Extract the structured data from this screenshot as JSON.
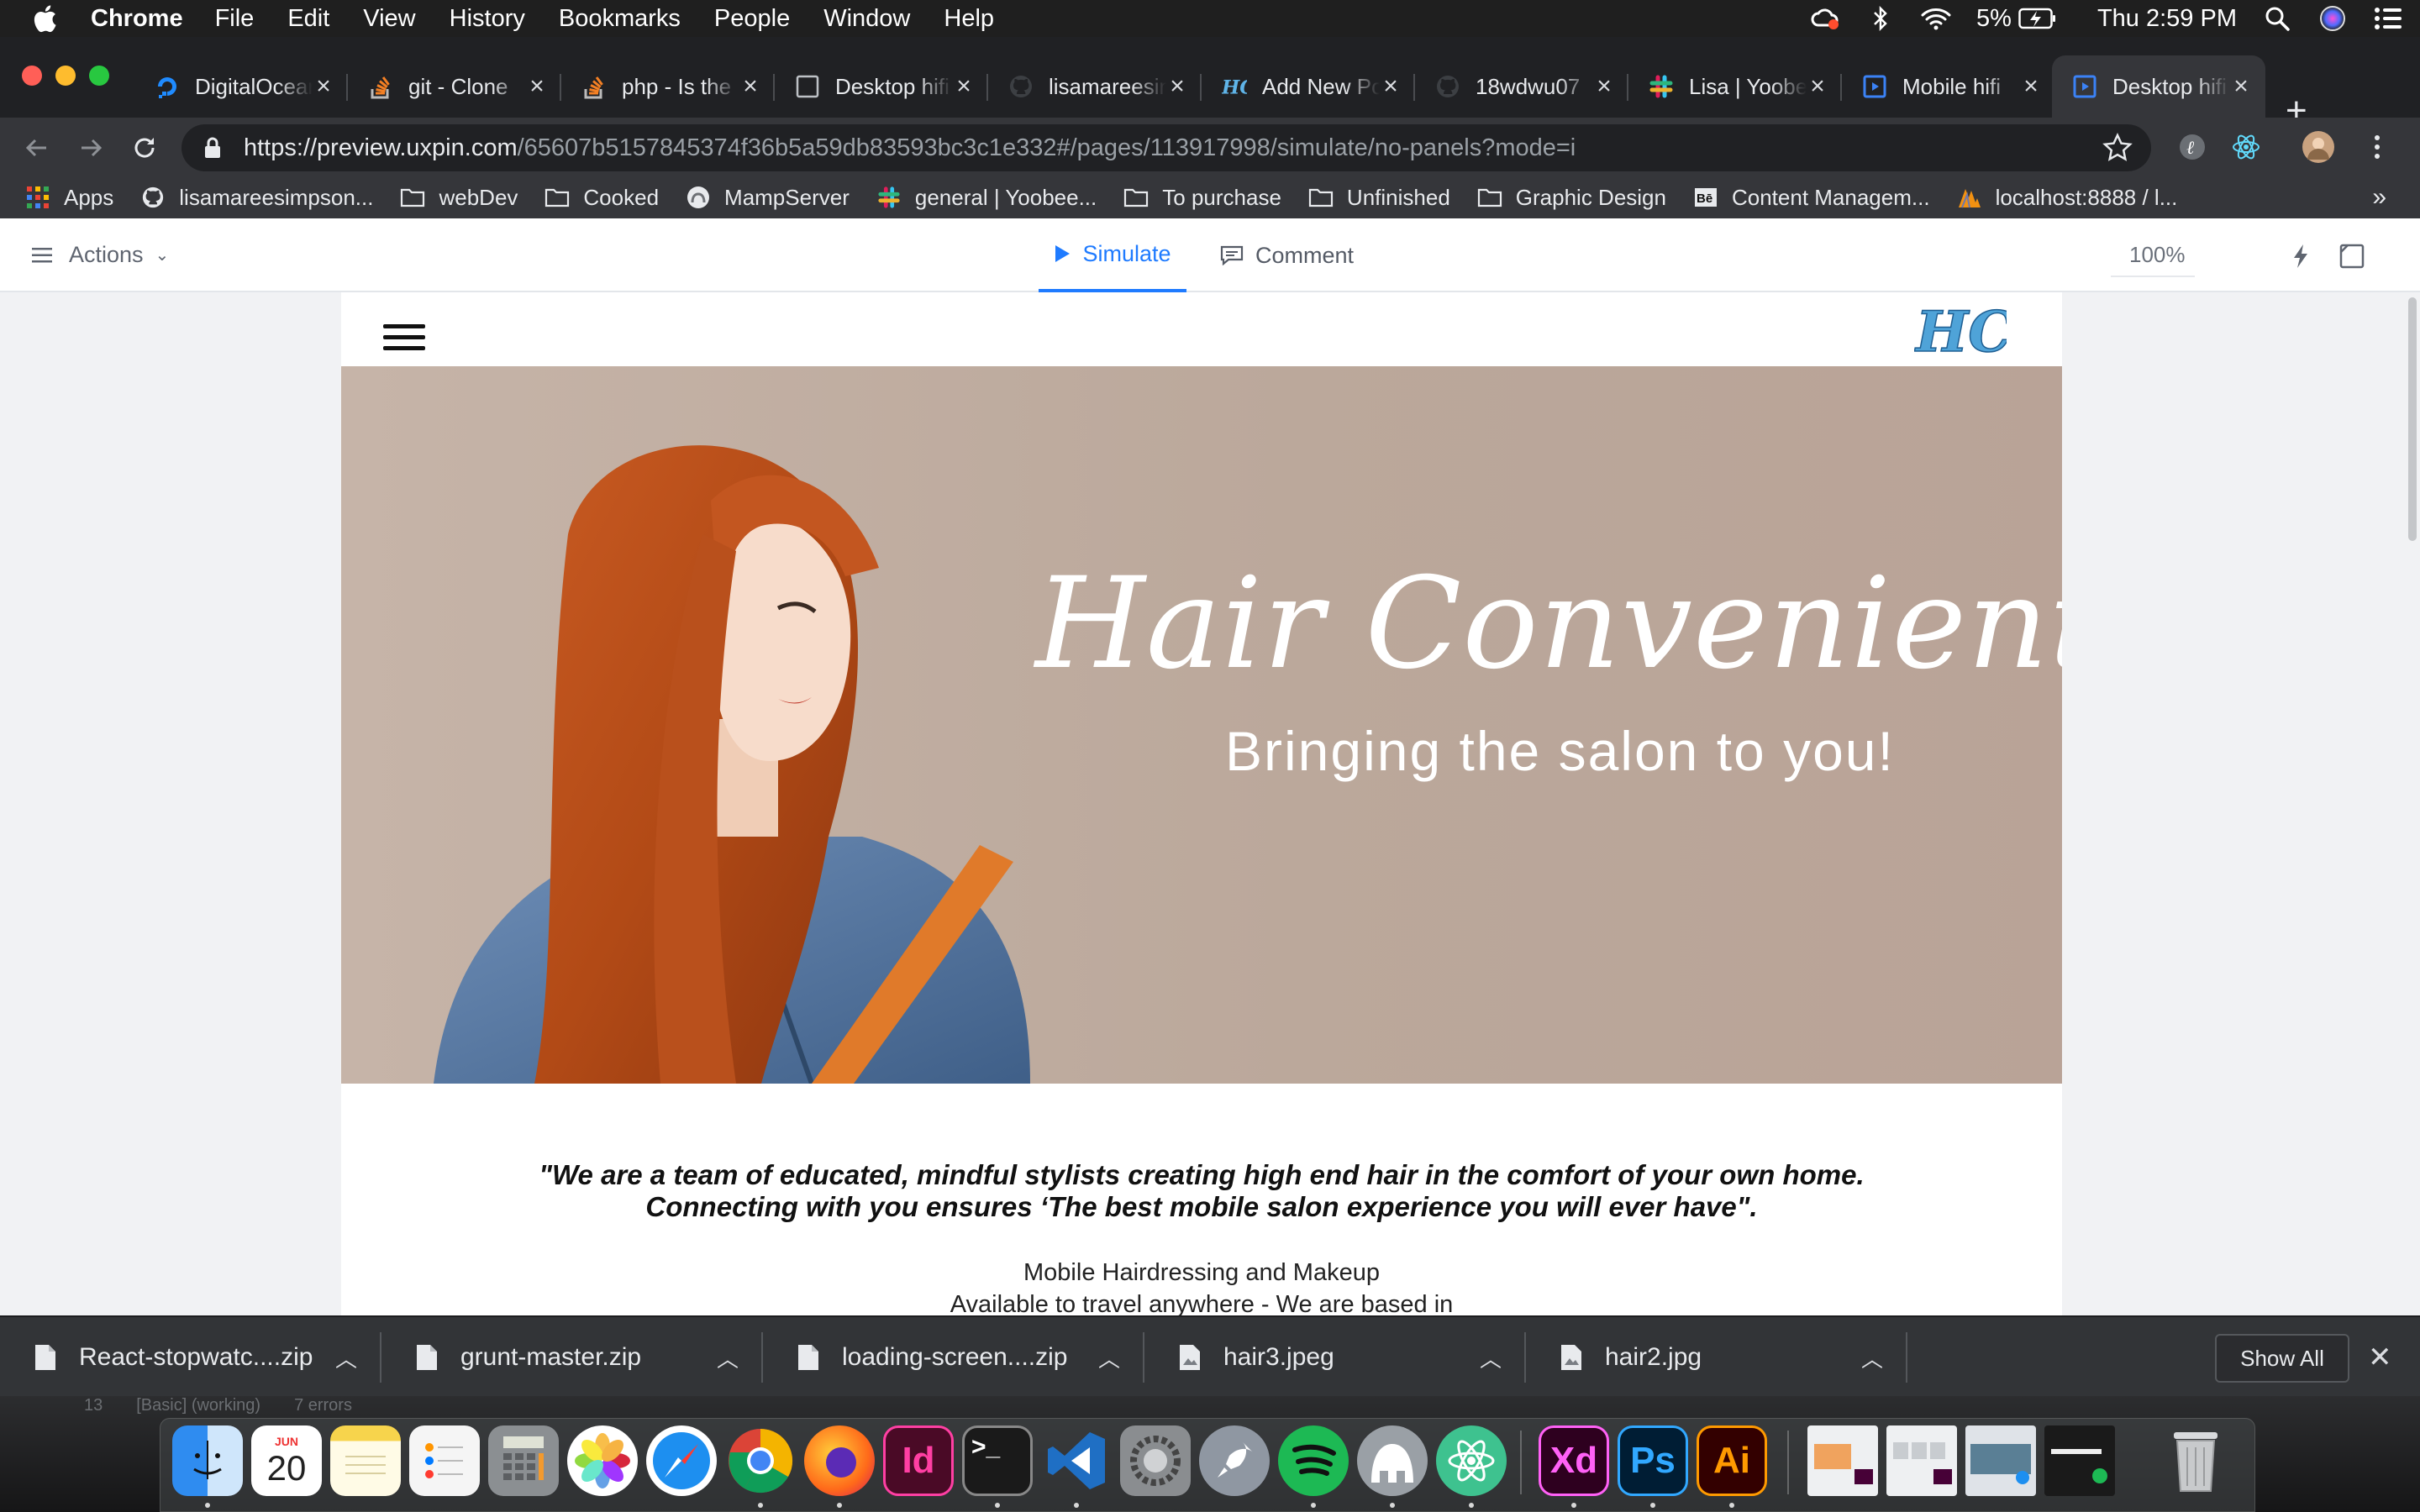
{
  "menubar": {
    "app_name": "Chrome",
    "items": [
      "File",
      "Edit",
      "View",
      "History",
      "Bookmarks",
      "People",
      "Window",
      "Help"
    ],
    "battery": "5%",
    "clock": "Thu 2:59 PM"
  },
  "tabs": [
    {
      "label": "DigitalOcean",
      "icon": "digitalocean-icon",
      "active": false
    },
    {
      "label": "git - Clone",
      "icon": "stackoverflow-icon",
      "active": false
    },
    {
      "label": "php - Is the",
      "icon": "stackoverflow-icon",
      "active": false
    },
    {
      "label": "Desktop hifi",
      "icon": "page-icon",
      "active": false
    },
    {
      "label": "lisamareesimpson",
      "icon": "github-icon",
      "active": false
    },
    {
      "label": "Add New Post",
      "icon": "hc-logo-icon",
      "active": false
    },
    {
      "label": "18wdwu07",
      "icon": "github-icon",
      "active": false
    },
    {
      "label": "Lisa | Yoobee",
      "icon": "slack-icon",
      "active": false
    },
    {
      "label": "Mobile hifi",
      "icon": "uxpin-icon",
      "active": false
    },
    {
      "label": "Desktop hifi",
      "icon": "uxpin-icon",
      "active": true
    }
  ],
  "address": {
    "host": "https://preview.uxpin.com",
    "path": "/65607b5157845374f36b5a59db83593bc3c1e332#/pages/113917998/simulate/no-panels?mode=i"
  },
  "bookmarks": [
    {
      "label": "Apps",
      "icon": "apps-grid-icon"
    },
    {
      "label": "lisamareesimpson...",
      "icon": "github-icon"
    },
    {
      "label": "webDev",
      "icon": "folder-icon"
    },
    {
      "label": "Cooked",
      "icon": "folder-icon"
    },
    {
      "label": "MampServer",
      "icon": "mamp-icon"
    },
    {
      "label": "general | Yoobee...",
      "icon": "slack-icon"
    },
    {
      "label": "To purchase",
      "icon": "folder-icon"
    },
    {
      "label": "Unfinished",
      "icon": "folder-icon"
    },
    {
      "label": "Graphic Design",
      "icon": "folder-icon"
    },
    {
      "label": "Content Managem...",
      "icon": "behance-icon"
    },
    {
      "label": "localhost:8888 / l...",
      "icon": "phpmyadmin-icon"
    }
  ],
  "bookmarks_more": "»",
  "uxpin": {
    "actions_label": "Actions",
    "simulate_label": "Simulate",
    "comment_label": "Comment",
    "zoom": "100%"
  },
  "site": {
    "logo": "HC",
    "hero_title": "Hair Conveniently",
    "hero_subtitle": "Bringing the salon to you!",
    "quote_line1": "\"We are a team of educated, mindful stylists creating high end hair in the comfort of your own home.",
    "quote_line2": "Connecting with you ensures ‘The best mobile salon experience you will ever have\".",
    "sub_line1": "Mobile Hairdressing and Makeup",
    "sub_line2": "Available to travel anywhere - We are based in"
  },
  "downloads": [
    {
      "name": "React-stopwatc....zip"
    },
    {
      "name": "grunt-master.zip"
    },
    {
      "name": "loading-screen....zip"
    },
    {
      "name": "hair3.jpeg"
    },
    {
      "name": "hair2.jpg"
    }
  ],
  "show_all_label": "Show All",
  "behind_window": {
    "counter": "13",
    "mode": "[Basic] (working)",
    "errors": "7 errors"
  },
  "dock": [
    {
      "name": "finder",
      "color": "#3d8ff0"
    },
    {
      "name": "calendar",
      "month": "JUN",
      "day": "20"
    },
    {
      "name": "notes",
      "color": "#f7d44c"
    },
    {
      "name": "reminders",
      "color": "#f5f5f5"
    },
    {
      "name": "calculator",
      "color": "#8b8f92"
    },
    {
      "name": "photos",
      "color": "#ffffff"
    },
    {
      "name": "safari",
      "color": "#1d8ff0"
    },
    {
      "name": "chrome",
      "color": "#ffffff"
    },
    {
      "name": "firefox",
      "color": "#ff7a1a"
    },
    {
      "name": "indesign",
      "label": "Id",
      "color": "#4a0a26",
      "accent": "#ff3fa3"
    },
    {
      "name": "terminal",
      "label": ">_",
      "color": "#1a1a1a",
      "accent": "#ffffff"
    },
    {
      "name": "vscode",
      "color": "#1f6fc4"
    },
    {
      "name": "system-preferences",
      "color": "#8a8d90"
    },
    {
      "name": "launchpad",
      "color": "#8f97a2"
    },
    {
      "name": "spotify",
      "color": "#1db954"
    },
    {
      "name": "mamp",
      "color": "#9aa0a6"
    },
    {
      "name": "atom",
      "color": "#3ec28f"
    },
    {
      "name": "xd",
      "label": "Xd",
      "color": "#2e001f",
      "accent": "#ff61f6"
    },
    {
      "name": "photoshop",
      "label": "Ps",
      "color": "#001d34",
      "accent": "#31a8ff"
    },
    {
      "name": "illustrator",
      "label": "Ai",
      "color": "#330000",
      "accent": "#ff9a00"
    },
    {
      "name": "trash",
      "color": "#c8cacc"
    }
  ]
}
